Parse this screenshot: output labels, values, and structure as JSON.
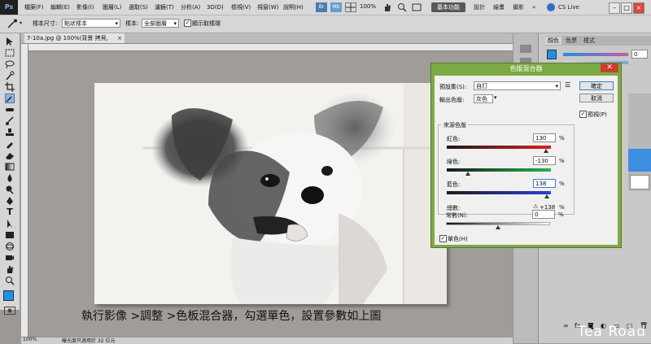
{
  "menu": {
    "app_logo": "Ps",
    "items": [
      "檔案(F)",
      "編輯(E)",
      "影像(I)",
      "圖層(L)",
      "選取(S)",
      "濾鏡(T)",
      "分析(A)",
      "3D(D)",
      "檢視(V)",
      "視窗(W)",
      "說明(H)"
    ],
    "zoom": "100%",
    "workspaces": [
      "基本功能",
      "設計",
      "繪畫",
      "攝影"
    ],
    "workspace_more": "»",
    "cs_live": "CS Live"
  },
  "options": {
    "sample_size_label": "樣本尺寸:",
    "sample_size_value": "點狀樣本",
    "sample_label": "樣本:",
    "sample_value": "全部圖層",
    "show_ring_label": "顯示取樣環"
  },
  "document": {
    "tab_title": "7-10a.jpg @ 100%(背景 拷貝, RGB/8#) *",
    "zoom_status": "100%",
    "status_text": "曝光度只適用於 32 位元"
  },
  "panels": {
    "tabs": [
      "顏色",
      "色票",
      "樣式"
    ],
    "color_value": "0"
  },
  "dialog": {
    "title": "色版混合器",
    "preset_label": "預設集(S):",
    "preset_value": "自訂",
    "output_label": "輸出色版:",
    "output_value": "灰色",
    "group_label": "來源色版",
    "red_label": "紅色:",
    "red_value": "130",
    "green_label": "綠色:",
    "green_value": "-130",
    "blue_label": "藍色:",
    "blue_value": "138",
    "percent": "%",
    "total_label": "總數:",
    "total_value": "+138",
    "constant_label": "常數(N):",
    "constant_value": "0",
    "mono_label": "單色(H)",
    "ok_label": "確定",
    "cancel_label": "取消",
    "preview_label": "預視(P)",
    "mono_checked": true,
    "preview_checked": true
  },
  "caption": "執行影像 >調整 >色板混合器，勾選單色，設置參數如上圖",
  "watermark": "Tea Road",
  "colors": {
    "dialog_frame": "#7eaa45",
    "close_red": "#c7412e",
    "foreground_swatch": "#1e90e6"
  }
}
